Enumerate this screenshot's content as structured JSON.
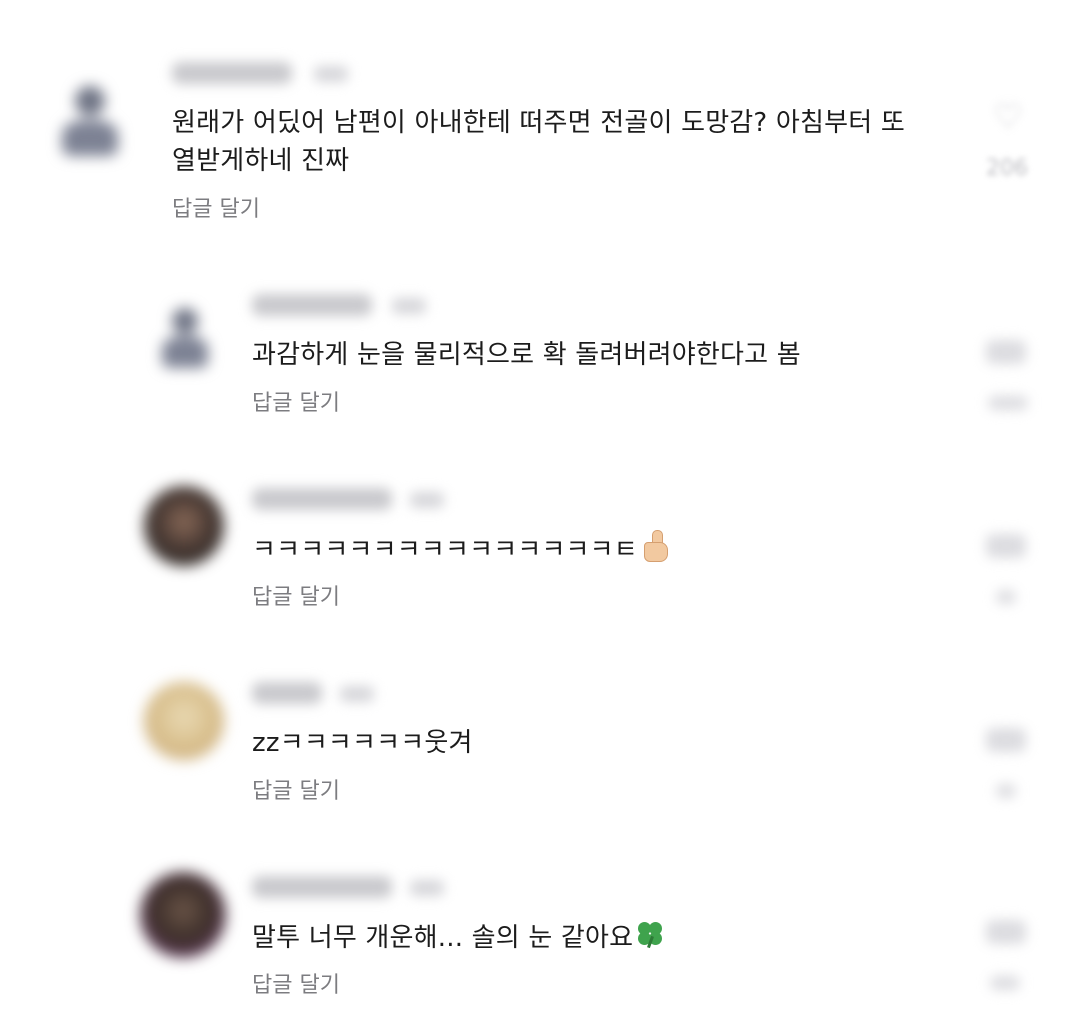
{
  "comments": [
    {
      "text_line1": "원래가 어딨어 남편이 아내한테 떠주면 전골이 도망감? 아침부터 또",
      "text_line2": "열받게하네 진짜",
      "reply_label": "답글 달기",
      "like_count": "206"
    },
    {
      "text": "과감하게 눈을 물리적으로 확 돌려버려야한다고 봄",
      "reply_label": "답글 달기"
    },
    {
      "text": "ㅋㅋㅋㅋㅋㅋㅋㅋㅋㅋㅋㅋㅋㅋㅋㅌ",
      "emoji": "thumbs-up",
      "reply_label": "답글 달기"
    },
    {
      "text": "zzㅋㅋㅋㅋㅋㅋ웃겨",
      "reply_label": "답글 달기"
    },
    {
      "text": "말투 너무 개운해... 솔의 눈 같아요",
      "emoji": "four-leaf-clover",
      "reply_label": "답글 달기"
    }
  ],
  "icons": {
    "like": "heart-icon"
  },
  "colors": {
    "text": "#1c1c1c",
    "reply": "#7c7c80",
    "muted": "#c7c7cb"
  }
}
